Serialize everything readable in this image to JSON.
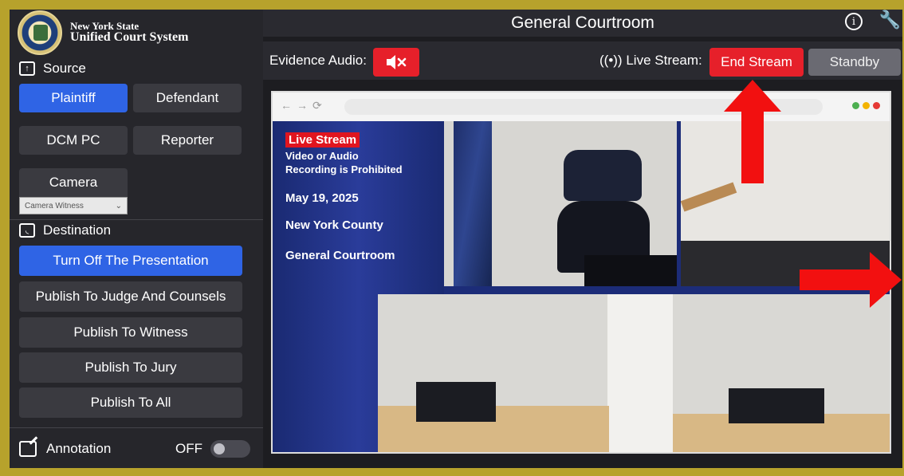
{
  "logo": {
    "line1": "New York State",
    "line2": "Unified Court System"
  },
  "source": {
    "heading": "Source",
    "buttons": [
      "Plaintiff",
      "Defendant",
      "DCM PC",
      "Reporter",
      "Camera"
    ],
    "camera_select": "Camera Witness"
  },
  "destination": {
    "heading": "Destination",
    "buttons": [
      "Turn Off The Presentation",
      "Publish To Judge And Counsels",
      "Publish To Witness",
      "Publish To Jury",
      "Publish To All"
    ]
  },
  "annotation": {
    "label": "Annotation",
    "state": "OFF"
  },
  "header": {
    "title": "General Courtroom"
  },
  "toolbar": {
    "evidence_label": "Evidence Audio:",
    "live_label": "Live Stream:",
    "end_stream": "End Stream",
    "standby": "Standby"
  },
  "slide": {
    "tag": "Live Stream",
    "warning_line1": "Video or Audio",
    "warning_line2": "Recording is Prohibited",
    "date": "May 19, 2025",
    "county": "New York County",
    "courtroom": "General Courtroom"
  },
  "colors": {
    "accent_blue": "#2f64e5",
    "stream_red": "#e6202a",
    "frame_gold": "#b7a22c"
  }
}
